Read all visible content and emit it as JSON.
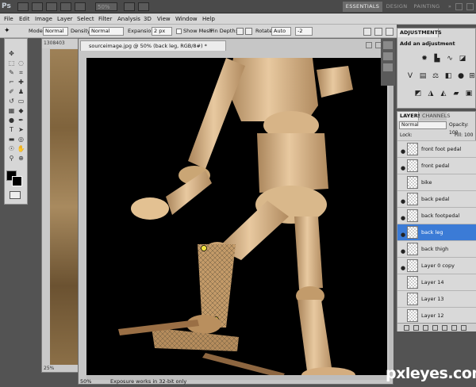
{
  "app": {
    "logo": "Ps",
    "zoom": "50%"
  },
  "workspaces": {
    "essentials": "ESSENTIALS",
    "design": "DESIGN",
    "painting": "PAINTING",
    "more": "»"
  },
  "menu": [
    "File",
    "Edit",
    "Image",
    "Layer",
    "Select",
    "Filter",
    "Analysis",
    "3D",
    "View",
    "Window",
    "Help"
  ],
  "options": {
    "mode_label": "Mode:",
    "mode_value": "Normal",
    "density_label": "Density:",
    "density_value": "Normal",
    "expansion_label": "Expansion:",
    "expansion_value": "2 px",
    "show_mesh_label": "Show Mesh",
    "pin_depth_label": "Pin Depth:",
    "rotate_label": "Rotate:",
    "rotate_value": "Auto",
    "rotate_degrees": "-2"
  },
  "bg_document": {
    "title": "1308403",
    "zoom": "25%"
  },
  "document": {
    "tab_title": "sourceimage.jpg @ 50% (back leg, RGB/8#) *",
    "zoom": "50%",
    "status": "Exposure works in 32-bit only"
  },
  "adjustments": {
    "tab": "ADJUSTMENTS",
    "header": "Add an adjustment"
  },
  "layers_panel": {
    "tab_layers": "LAYERS",
    "tab_channels": "CHANNELS",
    "blend": "Normal",
    "opacity_label": "Opacity: 100",
    "lock_label": "Lock:",
    "fill_label": "Fill: 100",
    "layers": [
      {
        "name": "front foot pedal",
        "visible": true,
        "selected": false
      },
      {
        "name": "front pedal",
        "visible": true,
        "selected": false
      },
      {
        "name": "bike",
        "visible": false,
        "selected": false
      },
      {
        "name": "back pedal",
        "visible": true,
        "selected": false
      },
      {
        "name": "back footpedal",
        "visible": true,
        "selected": false
      },
      {
        "name": "back leg",
        "visible": true,
        "selected": true
      },
      {
        "name": "back thigh",
        "visible": true,
        "selected": false
      },
      {
        "name": "Layer 0 copy",
        "visible": true,
        "selected": false
      },
      {
        "name": "Layer 14",
        "visible": false,
        "selected": false
      },
      {
        "name": "Layer 13",
        "visible": false,
        "selected": false
      },
      {
        "name": "Layer 12",
        "visible": false,
        "selected": false
      }
    ]
  },
  "watermark": "pxleyes.com"
}
